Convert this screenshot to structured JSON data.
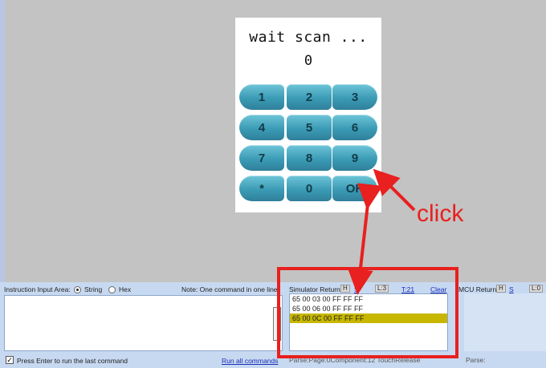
{
  "simulator": {
    "status_text": "wait scan ...",
    "value_text": "0",
    "keys": [
      "1",
      "2",
      "3",
      "4",
      "5",
      "6",
      "7",
      "8",
      "9",
      "*",
      "0",
      "OK"
    ]
  },
  "annotation": {
    "click_label": "click",
    "color": "#e8201f"
  },
  "instruction_panel": {
    "label": "Instruction Input Area:",
    "format_options": [
      "String",
      "Hex"
    ],
    "selected_format": "String",
    "note": "Note: One command in one line",
    "input_value": "",
    "press_enter_label": "Press Enter to run the last command",
    "press_enter_checked": true,
    "run_all_label": "Run all commands"
  },
  "simulator_return": {
    "label": "Simulator Return:",
    "h_label": "H",
    "s_label": "S",
    "l_label": "L:3",
    "t_label": "T:21",
    "clear_label": "Clear",
    "rows": [
      "65 00 03 00 FF FF FF",
      "65 00 06 00 FF FF FF",
      "65 00 0C 00 FF FF FF"
    ],
    "selected_index": 2,
    "parse_text": "Parse:Page:0Component:12 TouchRelease"
  },
  "mcu_return": {
    "label": "MCU Return:",
    "h_label": "H",
    "s_label": "S",
    "l_label": "L:0",
    "parse_text": "Parse:"
  }
}
